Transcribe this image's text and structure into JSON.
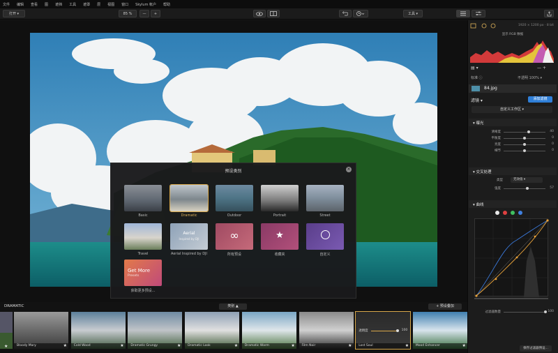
{
  "menu": [
    "文件",
    "编辑",
    "查看",
    "图",
    "遮挡",
    "工具",
    "遮罩",
    "层",
    "视图",
    "窗口",
    "Skylum 帐户",
    "帮助"
  ],
  "toolbar": {
    "open_label": "打开 ▾",
    "zoom_label": "85 %",
    "zoom_out": "—",
    "zoom_in": "+",
    "tools_label": "工具 ▾"
  },
  "dialog": {
    "title": "预设类别",
    "close": "×",
    "presets": [
      {
        "label": "Basic",
        "sel": false
      },
      {
        "label": "Dramatic",
        "sel": true
      },
      {
        "label": "Outdoor",
        "sel": false
      },
      {
        "label": "Portrait",
        "sel": false
      },
      {
        "label": "Street",
        "sel": false
      },
      {
        "label": "Travel",
        "sel": false
      },
      {
        "label": "Aerial Inspired by DJI",
        "sel": false
      },
      {
        "label": "所有预设",
        "sel": false
      },
      {
        "label": "收藏夹",
        "sel": false
      },
      {
        "label": "自定义",
        "sel": false
      },
      {
        "label": "获取更多预设...",
        "sel": false
      }
    ],
    "aerial_thumb_text": "Aerial",
    "aerial_thumb_sub": "Inspired by DJI",
    "getmore_title": "Get More",
    "getmore_sub": "Presets"
  },
  "strip": {
    "category": "DRAMATIC",
    "category_btn": "类别 ▲",
    "add_preset": "+ 预设叠加",
    "films": [
      {
        "label": "Bloody Mary"
      },
      {
        "label": "Cold Wood"
      },
      {
        "label": "Dramatic Grungy"
      },
      {
        "label": "Dramatic Look"
      },
      {
        "label": "Dramatic Warm"
      },
      {
        "label": "Film Noir"
      },
      {
        "label": "Lost Soul"
      },
      {
        "label": "Mood Enhancer"
      }
    ],
    "lost_soul_opacity_label": "透明度",
    "lost_soul_opacity_value": "100"
  },
  "panel": {
    "size_info": "1920 × 1200 px · 8 bit",
    "histogram_label": "显示 RGB 数据",
    "layers_label": "标准 ⓘ",
    "opacity_label": "不透明 100% ▾",
    "filename": "84.jpg",
    "filters_label": "滤镜 ▾",
    "add_filter_btn": "添加滤镜",
    "workspace": "自定义工作区 ▾",
    "sec1": {
      "title": "▾ 曝光",
      "sliders": [
        {
          "label": "清晰度",
          "value": "40",
          "pos": 0.6
        },
        {
          "label": "平衡度",
          "value": "0",
          "pos": 0.5
        },
        {
          "label": "亮度",
          "value": "0",
          "pos": 0.5
        },
        {
          "label": "细节",
          "value": "0",
          "pos": 0.5
        }
      ]
    },
    "sec2": {
      "title": "▾ 交叉处理",
      "type_label": "类型",
      "type_value": "无效值 ▾",
      "sliders": [
        {
          "label": "强度",
          "value": "57",
          "pos": 0.57
        }
      ]
    },
    "sec3": {
      "title": "▾ 曲线"
    },
    "curve_dots": [
      "#e8e8e8",
      "#e04040",
      "#40c060",
      "#4080e0"
    ],
    "bottom_slider": {
      "label": "过滤器数量",
      "value": "100",
      "pos": 1.0
    },
    "save_btn": "保存过滤器预设..."
  }
}
